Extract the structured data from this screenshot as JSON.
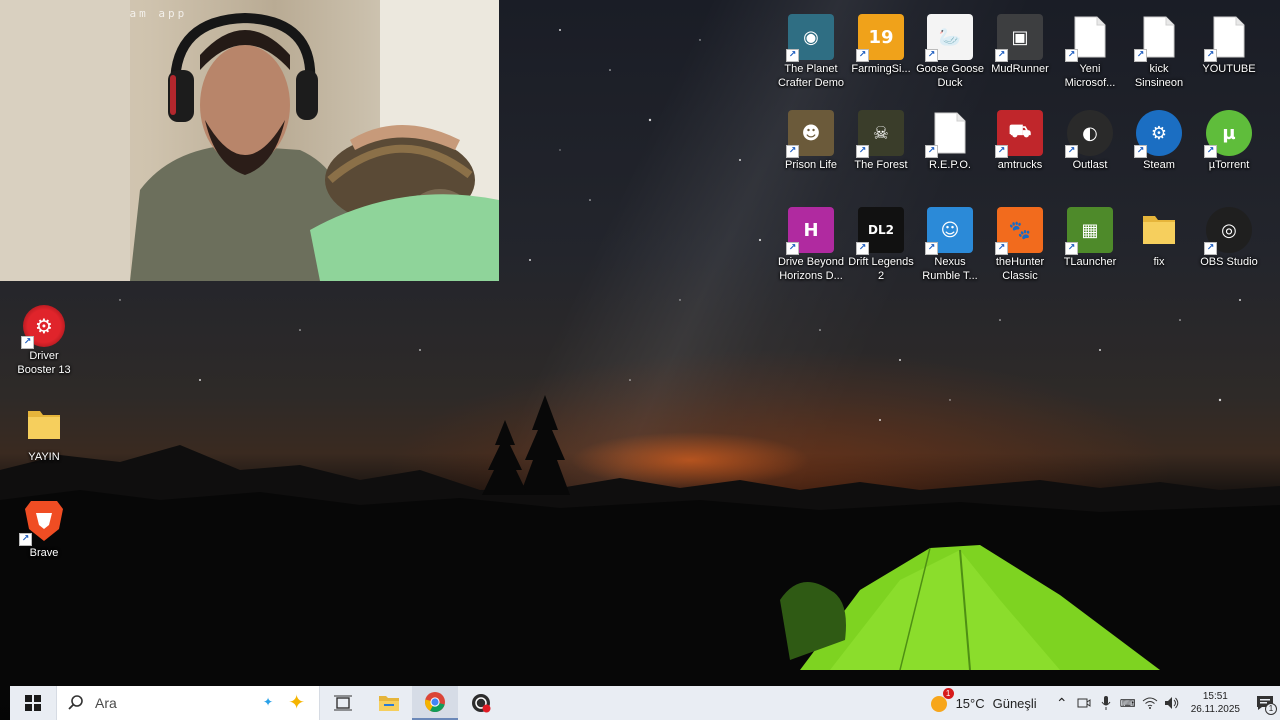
{
  "webcam": {
    "watermark": "using droidcam app"
  },
  "left_icons": [
    {
      "label_lines": [
        "Driver",
        "Booster 13"
      ],
      "icon": "driver-booster-icon"
    },
    {
      "label_lines": [
        "YAYIN",
        ""
      ],
      "icon": "folder-icon"
    },
    {
      "label_lines": [
        "Brave",
        ""
      ],
      "icon": "brave-icon"
    }
  ],
  "grid_icons": [
    {
      "label_lines": [
        "The Planet",
        "Crafter Demo"
      ],
      "icon": "planet-crafter-icon",
      "color": "#2f6e83"
    },
    {
      "label_lines": [
        "FarmingSi...",
        ""
      ],
      "icon": "farming-simulator-icon",
      "color": "#f0a21a"
    },
    {
      "label_lines": [
        "Goose Goose",
        "Duck"
      ],
      "icon": "goose-goose-duck-icon",
      "color": "#f4f4f4"
    },
    {
      "label_lines": [
        "MudRunner",
        ""
      ],
      "icon": "mudrunner-icon",
      "color": "#3d3e40"
    },
    {
      "label_lines": [
        "Yeni",
        "Microsof..."
      ],
      "icon": "document-icon",
      "color": "#ffffff"
    },
    {
      "label_lines": [
        "kick",
        "Sinsineon"
      ],
      "icon": "document-icon",
      "color": "#ffffff"
    },
    {
      "label_lines": [
        "YOUTUBE",
        ""
      ],
      "icon": "document-icon",
      "color": "#ffffff"
    },
    {
      "label_lines": [
        "Prison Life",
        ""
      ],
      "icon": "prison-life-icon",
      "color": "#6b5a3a"
    },
    {
      "label_lines": [
        "The Forest",
        ""
      ],
      "icon": "the-forest-icon",
      "color": "#3a3d2a"
    },
    {
      "label_lines": [
        "R.E.P.O.",
        ""
      ],
      "icon": "document-icon",
      "color": "#ffffff"
    },
    {
      "label_lines": [
        "amtrucks",
        ""
      ],
      "icon": "amtrucks-icon",
      "color": "#c0262b"
    },
    {
      "label_lines": [
        "Outlast",
        ""
      ],
      "icon": "outlast-icon",
      "color": "#2a2a2a"
    },
    {
      "label_lines": [
        "Steam",
        ""
      ],
      "icon": "steam-icon",
      "color": "#1b6ec2"
    },
    {
      "label_lines": [
        "µTorrent",
        ""
      ],
      "icon": "utorrent-icon",
      "color": "#5fbd3b"
    },
    {
      "label_lines": [
        "Drive Beyond",
        "Horizons D..."
      ],
      "icon": "drive-beyond-horizons-icon",
      "color": "#b02aa0"
    },
    {
      "label_lines": [
        "Drift Legends",
        "2"
      ],
      "icon": "drift-legends-icon",
      "color": "#111111"
    },
    {
      "label_lines": [
        "Nexus",
        "Rumble T..."
      ],
      "icon": "nexus-rumble-icon",
      "color": "#2b8ad8"
    },
    {
      "label_lines": [
        "theHunter",
        "Classic"
      ],
      "icon": "thehunter-icon",
      "color": "#f26b1d"
    },
    {
      "label_lines": [
        "TLauncher",
        ""
      ],
      "icon": "tlauncher-icon",
      "color": "#4e8a2a"
    },
    {
      "label_lines": [
        "fix",
        ""
      ],
      "icon": "folder-icon",
      "color": "#f2c14e"
    },
    {
      "label_lines": [
        "OBS Studio",
        ""
      ],
      "icon": "obs-icon",
      "color": "#1f1f1f"
    }
  ],
  "taskbar": {
    "search_placeholder": "Ara",
    "weather_temp": "15°C",
    "weather_text": "Güneşli",
    "weather_badge": "1",
    "time": "15:51",
    "date": "26.11.2025",
    "notification_count": "1",
    "input_indicator": "ENG"
  },
  "colors": {
    "taskbar_bg": "#e9edf3",
    "accent": "#1a5bbf",
    "tent": "#7ed321"
  }
}
